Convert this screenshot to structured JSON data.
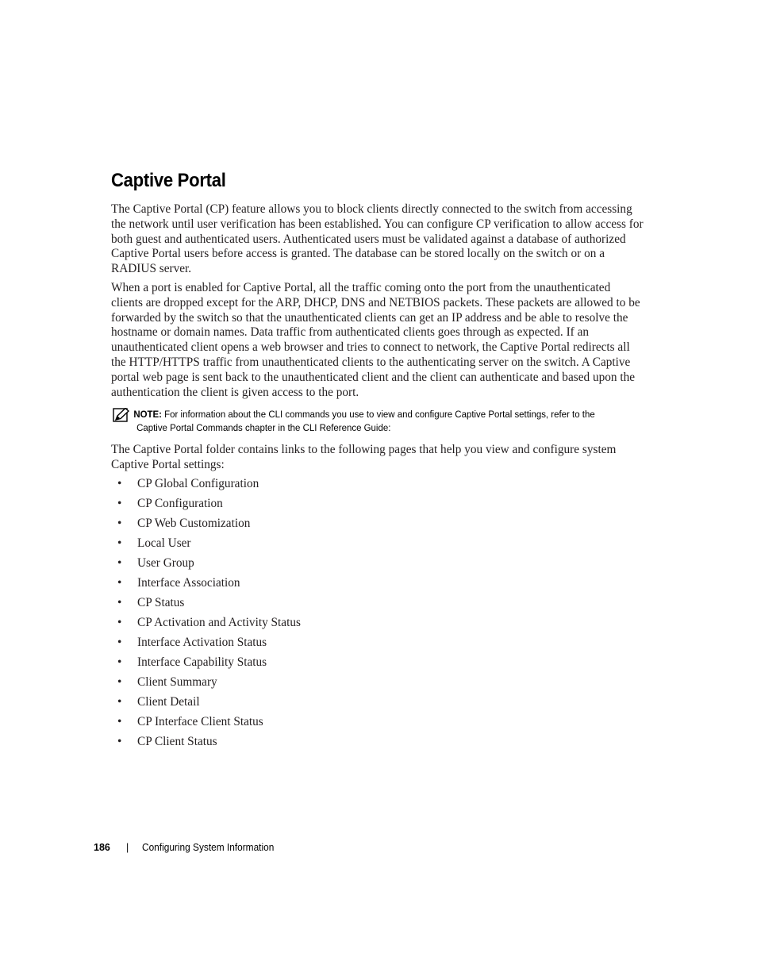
{
  "heading": "Captive Portal",
  "paragraphs": {
    "intro": "The Captive Portal (CP) feature allows you to block clients directly connected to the switch from accessing the network until user verification has been established. You can configure CP verification to allow access for both guest and authenticated users. Authenticated users must be validated against a database of authorized Captive Portal users before access is granted. The database can be stored locally on the switch or on a RADIUS server.",
    "traffic": "When a port is enabled for Captive Portal, all the traffic coming onto the port from the unauthenticated clients are dropped except for the ARP, DHCP, DNS and NETBIOS packets. These packets are allowed to be forwarded by the switch so that the unauthenticated clients can get an IP address and be able to resolve the hostname or domain names. Data traffic from authenticated clients goes through as expected. If an unauthenticated client opens a web browser and tries to connect to network, the Captive Portal redirects all the HTTP/HTTPS traffic from unauthenticated clients to the authenticating server on the switch. A Captive portal web page is sent back to the unauthenticated client and the client can authenticate and based upon the authentication the client is given access to the port.",
    "folder": "The Captive Portal folder contains links to the following pages that help you view and configure system Captive Portal settings:"
  },
  "note": {
    "icon": "pencil-note-icon",
    "label": "NOTE:",
    "line1": "For information about the CLI commands you use to view and configure Captive Portal settings, refer to the",
    "line2": "Captive Portal Commands chapter in the CLI Reference Guide:"
  },
  "bullet_char": "•",
  "links": [
    "CP Global Configuration",
    "CP Configuration",
    "CP Web Customization",
    "Local User",
    "User Group",
    "Interface Association",
    "CP Status",
    "CP Activation and Activity Status",
    "Interface Activation Status",
    "Interface Capability Status",
    "Client Summary",
    "Client Detail",
    "CP Interface Client Status",
    "CP Client Status"
  ],
  "footer": {
    "page_number": "186",
    "separator": "|",
    "chapter_title": "Configuring System Information"
  }
}
